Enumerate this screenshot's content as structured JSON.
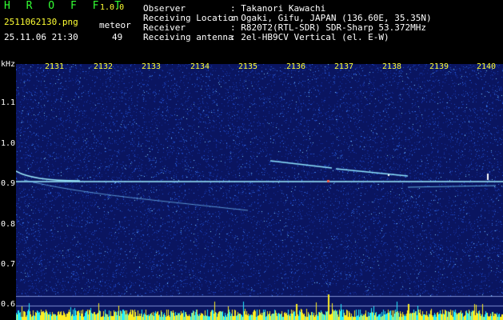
{
  "app": {
    "title": "H R O F F T",
    "version": "1.0.0"
  },
  "file": {
    "name": "2511062130.png",
    "date": "25.11.06 21:30"
  },
  "detection": {
    "mode": "meteor",
    "count": "49"
  },
  "info": [
    {
      "label": "Observer",
      "value": ": Takanori Kawachi"
    },
    {
      "label": "Receiving Location",
      "value": ": Ogaki, Gifu, JAPAN (136.60E, 35.35N)"
    },
    {
      "label": "Receiver",
      "value": ": R820T2(RTL-SDR) SDR-Sharp 53.372MHz"
    },
    {
      "label": "Receiving antenna",
      "value": ": 2el-HB9CV Vertical (el. E-W)"
    }
  ],
  "axis": {
    "unit": "kHz",
    "y_ticks": [
      "1.1",
      "1.0",
      "0.9",
      "0.8",
      "0.7",
      "0.6"
    ],
    "x_ticks": [
      "2131",
      "2132",
      "2133",
      "2134",
      "2135",
      "2136",
      "2137",
      "2138",
      "2139",
      "2140"
    ]
  },
  "colors": {
    "background": "#0a1560",
    "carrier": "#9fefff",
    "text_white": "#ffffff",
    "text_green": "#33ff33",
    "text_yellow": "#ffff33"
  }
}
